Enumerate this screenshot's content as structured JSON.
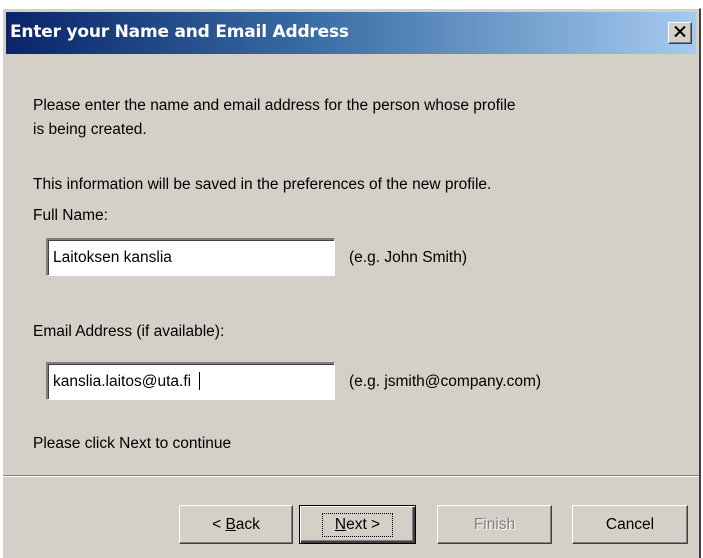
{
  "window": {
    "title": "Enter your Name and Email Address",
    "close_icon": "close-icon"
  },
  "intro": {
    "line1": "Please enter the name and email address for the person whose profile",
    "line2": "is being created.",
    "line3": "This information will be saved in the preferences of the new profile."
  },
  "full_name": {
    "label": "Full Name:",
    "value": "Laitoksen kanslia",
    "example": "(e.g. John Smith)"
  },
  "email": {
    "label": "Email Address (if available):",
    "value": "kanslia.laitos@uta.fi",
    "example": "(e.g. jsmith@company.com)"
  },
  "footer_hint": "Please click Next to continue",
  "buttons": {
    "back_prefix": "< ",
    "back_mnemonic": "B",
    "back_rest": "ack",
    "next_mnemonic": "N",
    "next_rest": "ext >",
    "finish": "Finish",
    "cancel": "Cancel"
  },
  "colors": {
    "titlebar_start": "#0a246a",
    "titlebar_end": "#a6caf0",
    "dialog_face": "#d4d0c8"
  }
}
